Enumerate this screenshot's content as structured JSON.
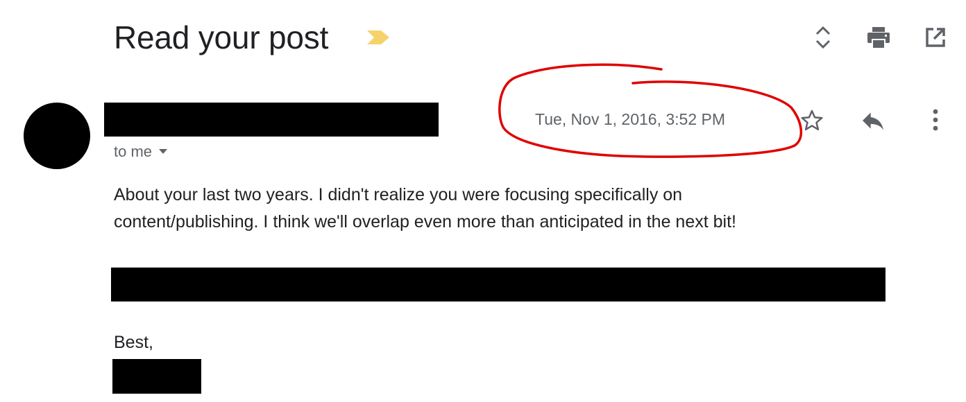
{
  "email": {
    "subject": "Read your post",
    "recipient_label": "to me",
    "date": "Tue, Nov 1, 2016, 3:52 PM",
    "body_lines": [
      "About your last two years. I didn't realize you were focusing specifically on",
      "content/publishing. I think we'll overlap even more than anticipated in the next bit!"
    ],
    "signoff": "Best,"
  },
  "icons": {
    "importance": "importance-marker-icon",
    "expand_collapse": "expand-collapse-icon",
    "print": "print-icon",
    "open_in_new_window": "open-in-new-window-icon",
    "star": "star-icon",
    "reply": "reply-icon",
    "more": "more-vert-icon"
  },
  "colors": {
    "importance_marker": "#f6d26b",
    "annotation_circle": "#e00000",
    "redaction": "#000000",
    "secondary_text": "#5f6368",
    "primary_text": "#202124"
  }
}
